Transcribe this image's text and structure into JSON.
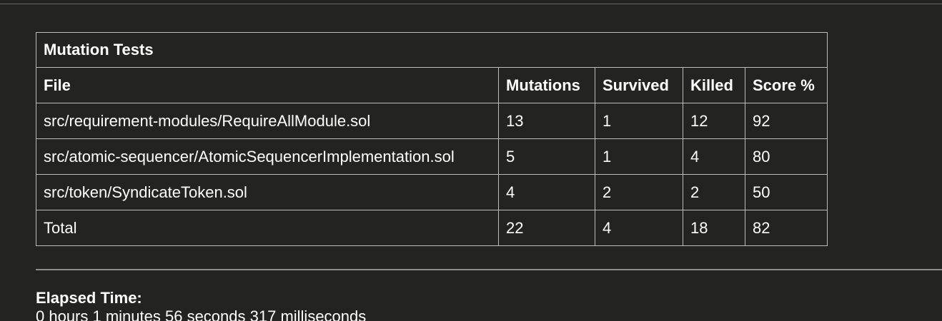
{
  "table": {
    "title": "Mutation Tests",
    "headers": [
      "File",
      "Mutations",
      "Survived",
      "Killed",
      "Score %"
    ],
    "rows": [
      [
        "src/requirement-modules/RequireAllModule.sol",
        "13",
        "1",
        "12",
        "92"
      ],
      [
        "src/atomic-sequencer/AtomicSequencerImplementation.sol",
        "5",
        "1",
        "4",
        "80"
      ],
      [
        "src/token/SyndicateToken.sol",
        "4",
        "2",
        "2",
        "50"
      ],
      [
        "Total",
        "22",
        "4",
        "18",
        "82"
      ]
    ]
  },
  "elapsed": {
    "label": "Elapsed Time:",
    "value": "0 hours 1 minutes 56 seconds 317 milliseconds"
  },
  "colors": {
    "background": "#232322",
    "border": "#bdbdbd",
    "text": "#ffffff"
  }
}
